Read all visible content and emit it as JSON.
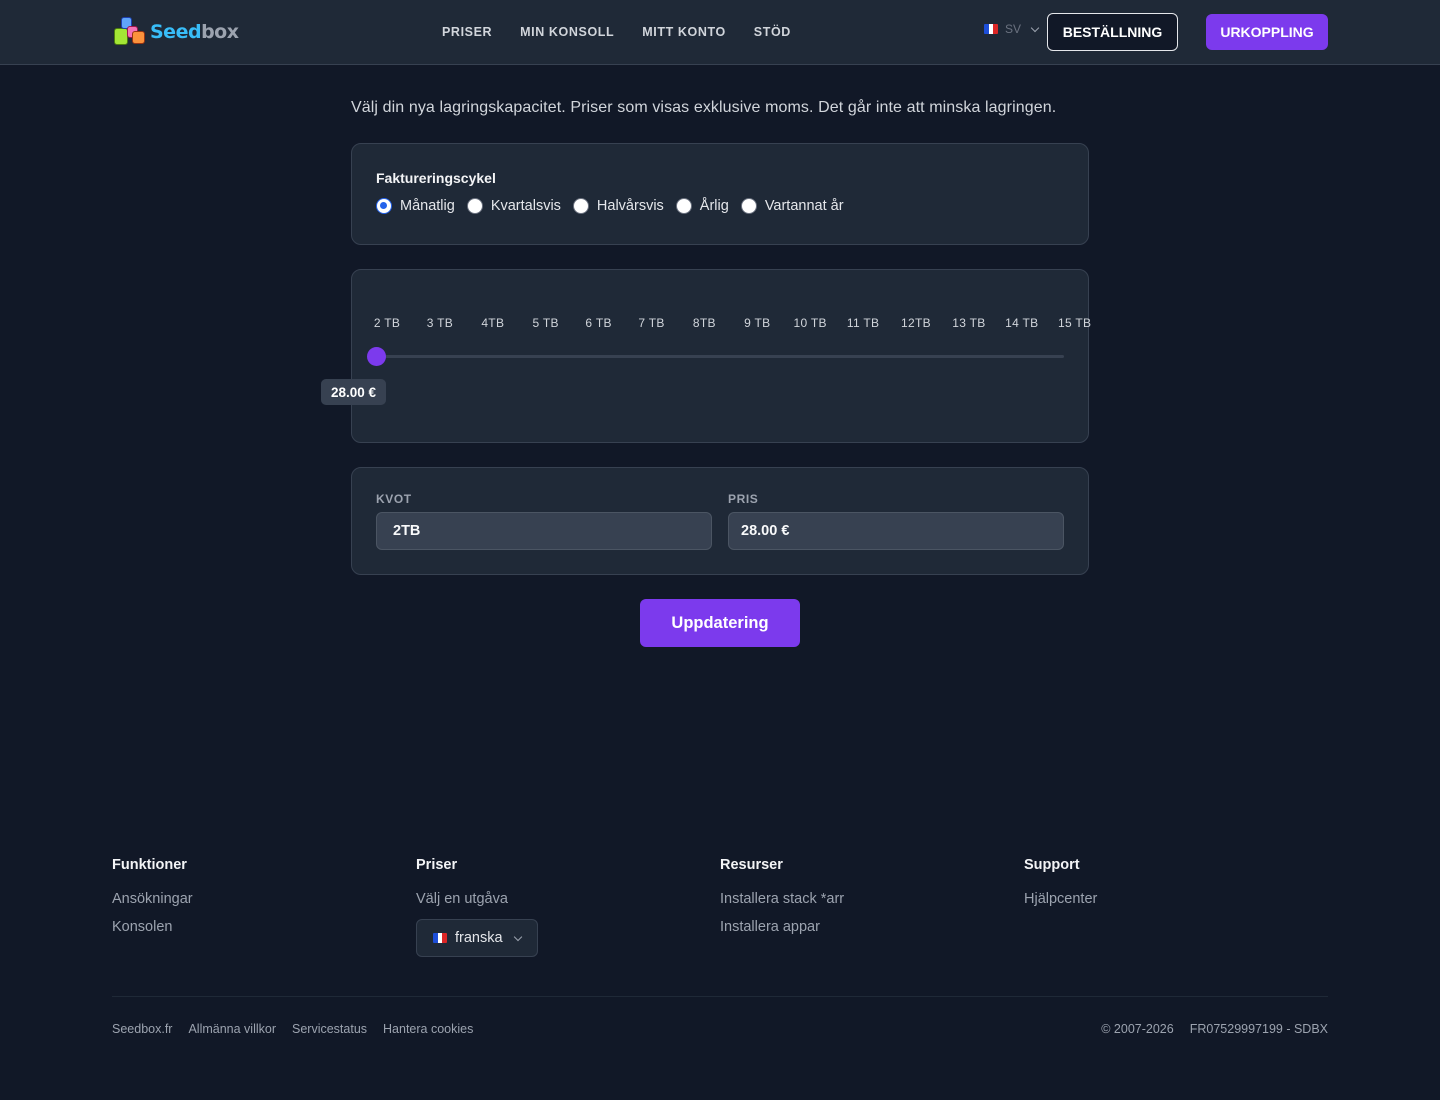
{
  "header": {
    "logo": {
      "part1": "Seed",
      "part2": "box"
    },
    "nav": [
      "PRISER",
      "MIN KONSOLL",
      "MITT KONTO",
      "STÖD"
    ],
    "language": {
      "code": "SV",
      "flag_colors": [
        "#1d4ed8",
        "#ffffff",
        "#dc2626"
      ]
    },
    "order_label": "BESTÄLLNING",
    "logout_label": "URKOPPLING"
  },
  "intro": "Välj din nya lagringskapacitet. Priser som visas exklusive moms. Det går inte att minska lagringen.",
  "billing": {
    "label": "Faktureringscykel",
    "options": [
      "Månatlig",
      "Kvartalsvis",
      "Halvårsvis",
      "Årlig",
      "Vartannat år"
    ],
    "selected": "Månatlig"
  },
  "storage_slider": {
    "ticks": [
      "2 TB",
      "3 TB",
      "4TB",
      "5 TB",
      "6 TB",
      "7 TB",
      "8TB",
      "9 TB",
      "10 TB",
      "11 TB",
      "12TB",
      "13 TB",
      "14 TB",
      "15 TB"
    ],
    "selected_index": 0,
    "price_tooltip": "28.00 €"
  },
  "fields": {
    "quota": {
      "label": "KVOT",
      "value": "2TB"
    },
    "price": {
      "label": "PRIS",
      "value": "28.00 €"
    }
  },
  "update_label": "Uppdatering",
  "footer": {
    "columns": [
      {
        "title": "Funktioner",
        "links": [
          "Ansökningar",
          "Konsolen"
        ]
      },
      {
        "title": "Priser",
        "links": [
          "Välj en utgåva"
        ]
      },
      {
        "title": "Resurser",
        "links": [
          "Installera stack *arr",
          "Installera appar"
        ]
      },
      {
        "title": "Support",
        "links": [
          "Hjälpcenter"
        ]
      }
    ],
    "language_select": "franska",
    "bottom_links": [
      "Seedbox.fr",
      "Allmänna villkor",
      "Servicestatus",
      "Hantera cookies"
    ],
    "copyright": "© 2007-2026",
    "company_id": "FR07529997199 - SDBX"
  },
  "colors": {
    "accent": "#7c3aed",
    "background": "#111827",
    "surface": "#1f2937",
    "radio_checked": "#2563eb"
  }
}
